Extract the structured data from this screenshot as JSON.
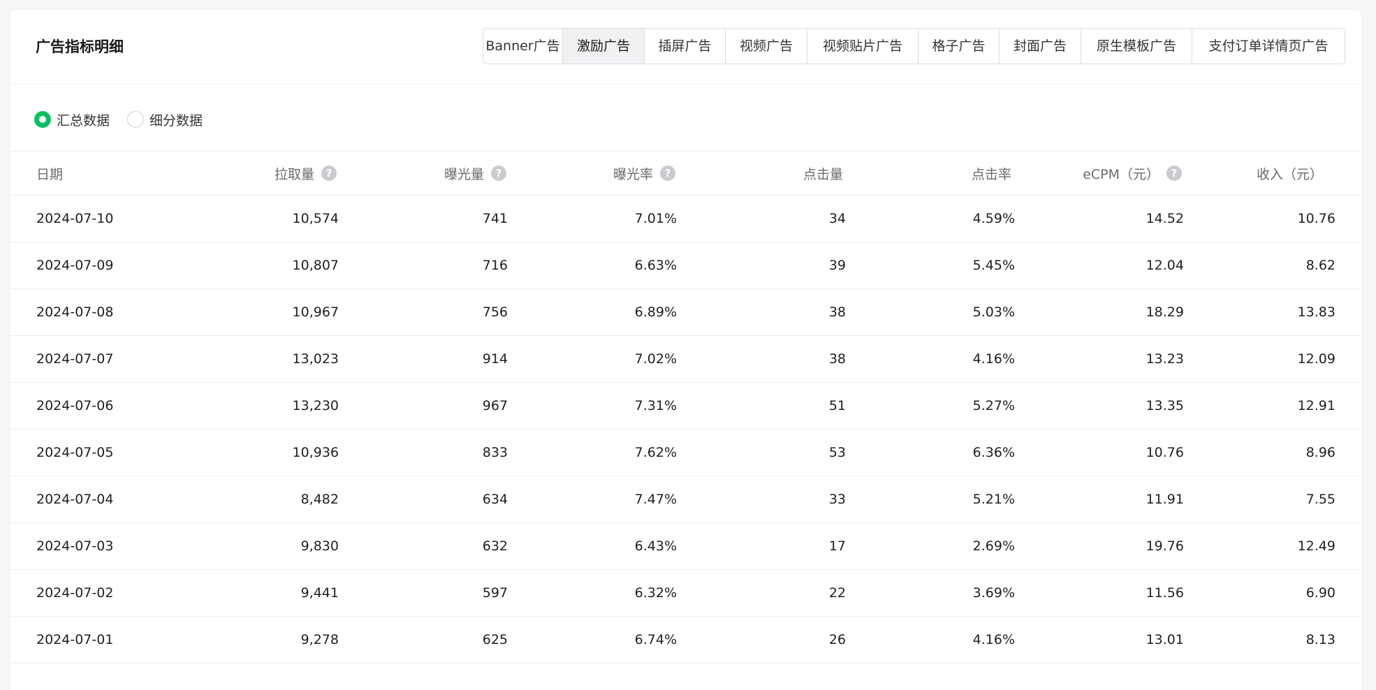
{
  "header": {
    "title": "广告指标明细",
    "tabs": [
      {
        "label": "Banner广告",
        "active": false
      },
      {
        "label": "激励广告",
        "active": true
      },
      {
        "label": "插屏广告",
        "active": false
      },
      {
        "label": "视频广告",
        "active": false
      },
      {
        "label": "视频贴片广告",
        "active": false
      },
      {
        "label": "格子广告",
        "active": false
      },
      {
        "label": "封面广告",
        "active": false
      },
      {
        "label": "原生模板广告",
        "active": false
      },
      {
        "label": "支付订单详情页广告",
        "active": false
      }
    ]
  },
  "view_mode": {
    "options": [
      {
        "label": "汇总数据",
        "checked": true
      },
      {
        "label": "细分数据",
        "checked": false
      }
    ]
  },
  "colors": {
    "accent": "#07c160",
    "active_tab_bg": "#f0f1f3",
    "help_icon": "#c9cbcf"
  },
  "table": {
    "columns": [
      {
        "label": "日期",
        "help": false
      },
      {
        "label": "拉取量",
        "help": true
      },
      {
        "label": "曝光量",
        "help": true
      },
      {
        "label": "曝光率",
        "help": true
      },
      {
        "label": "点击量",
        "help": false
      },
      {
        "label": "点击率",
        "help": false
      },
      {
        "label": "eCPM（元）",
        "help": true
      },
      {
        "label": "收入（元）",
        "help": false
      }
    ],
    "rows": [
      [
        "2024-07-10",
        "10,574",
        "741",
        "7.01%",
        "34",
        "4.59%",
        "14.52",
        "10.76"
      ],
      [
        "2024-07-09",
        "10,807",
        "716",
        "6.63%",
        "39",
        "5.45%",
        "12.04",
        "8.62"
      ],
      [
        "2024-07-08",
        "10,967",
        "756",
        "6.89%",
        "38",
        "5.03%",
        "18.29",
        "13.83"
      ],
      [
        "2024-07-07",
        "13,023",
        "914",
        "7.02%",
        "38",
        "4.16%",
        "13.23",
        "12.09"
      ],
      [
        "2024-07-06",
        "13,230",
        "967",
        "7.31%",
        "51",
        "5.27%",
        "13.35",
        "12.91"
      ],
      [
        "2024-07-05",
        "10,936",
        "833",
        "7.62%",
        "53",
        "6.36%",
        "10.76",
        "8.96"
      ],
      [
        "2024-07-04",
        "8,482",
        "634",
        "7.47%",
        "33",
        "5.21%",
        "11.91",
        "7.55"
      ],
      [
        "2024-07-03",
        "9,830",
        "632",
        "6.43%",
        "17",
        "2.69%",
        "19.76",
        "12.49"
      ],
      [
        "2024-07-02",
        "9,441",
        "597",
        "6.32%",
        "22",
        "3.69%",
        "11.56",
        "6.90"
      ],
      [
        "2024-07-01",
        "9,278",
        "625",
        "6.74%",
        "26",
        "4.16%",
        "13.01",
        "8.13"
      ]
    ]
  }
}
